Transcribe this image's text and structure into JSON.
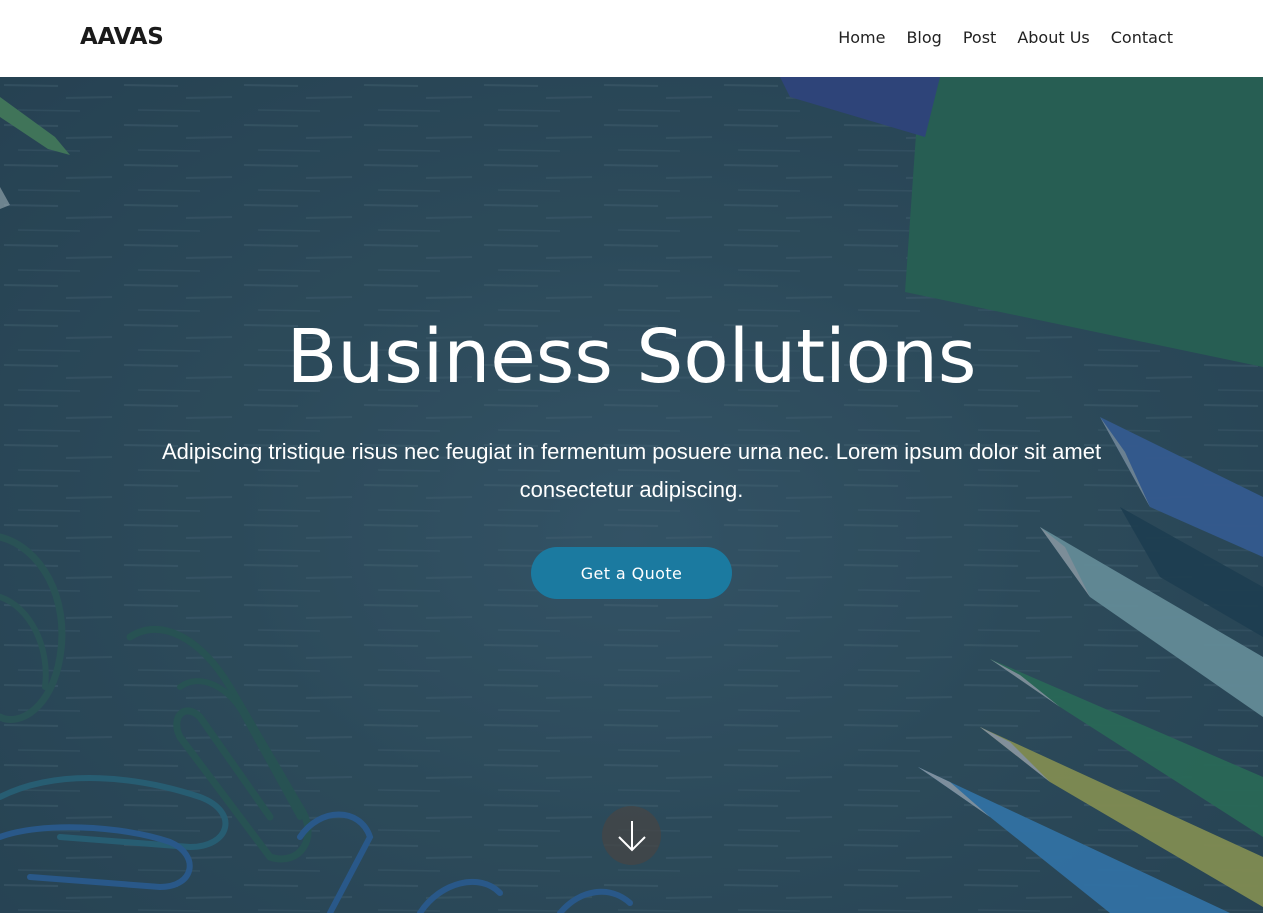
{
  "brand": {
    "name": "AAVAS"
  },
  "nav": {
    "items": [
      {
        "label": "Home"
      },
      {
        "label": "Blog"
      },
      {
        "label": "Post"
      },
      {
        "label": "About Us"
      },
      {
        "label": "Contact"
      }
    ]
  },
  "hero": {
    "title": "Business Solutions",
    "subtitle": "Adipiscing tristique risus nec feugiat in fermentum posuere urna nec. Lorem ipsum dolor sit amet consectetur adipiscing.",
    "cta_label": "Get a Quote",
    "scroll_icon": "arrow-down-icon"
  },
  "colors": {
    "header_bg": "#ffffff",
    "hero_tint": "#2e4a5c",
    "cta_bg": "#1b7aa0",
    "scroll_button_bg": "#464646"
  }
}
